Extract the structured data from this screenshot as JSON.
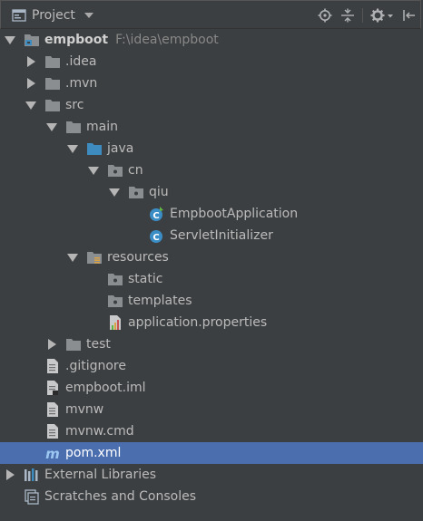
{
  "header": {
    "title": "Project",
    "icons": [
      "project-view-icon",
      "chevron-down-icon",
      "locate-icon",
      "collapse-all-icon",
      "gear-icon",
      "hide-icon"
    ]
  },
  "tree": {
    "items": [
      {
        "label": "empboot",
        "hint": "F:\\idea\\empboot",
        "icon": "module-folder-icon",
        "expanded": true
      },
      {
        "label": ".idea",
        "icon": "folder-icon",
        "expanded": false
      },
      {
        "label": ".mvn",
        "icon": "folder-icon",
        "expanded": false
      },
      {
        "label": "src",
        "icon": "folder-icon",
        "expanded": true
      },
      {
        "label": "main",
        "icon": "folder-icon",
        "expanded": true
      },
      {
        "label": "java",
        "icon": "source-folder-icon",
        "expanded": true
      },
      {
        "label": "cn",
        "icon": "package-icon",
        "expanded": true
      },
      {
        "label": "qiu",
        "icon": "package-icon",
        "expanded": true
      },
      {
        "label": "EmpbootApplication",
        "icon": "spring-boot-class-icon"
      },
      {
        "label": "ServletInitializer",
        "icon": "class-icon"
      },
      {
        "label": "resources",
        "icon": "resources-folder-icon",
        "expanded": true
      },
      {
        "label": "static",
        "icon": "package-icon"
      },
      {
        "label": "templates",
        "icon": "package-icon"
      },
      {
        "label": "application.properties",
        "icon": "properties-file-icon"
      },
      {
        "label": "test",
        "icon": "folder-icon",
        "expanded": false
      },
      {
        "label": ".gitignore",
        "icon": "text-file-icon"
      },
      {
        "label": "empboot.iml",
        "icon": "iml-file-icon"
      },
      {
        "label": "mvnw",
        "icon": "text-file-icon"
      },
      {
        "label": "mvnw.cmd",
        "icon": "text-file-icon"
      },
      {
        "label": "pom.xml",
        "icon": "maven-icon",
        "selected": true
      },
      {
        "label": "External Libraries",
        "icon": "libraries-icon",
        "expanded": false
      },
      {
        "label": "Scratches and Consoles",
        "icon": "scratches-icon"
      }
    ]
  },
  "colors": {
    "background": "#3c3f41",
    "selection": "#4b6eaf",
    "text": "#bbbbbb",
    "hint": "#888888",
    "folder": "#8a8e91",
    "source_folder": "#3d8bbf",
    "class_badge": "#3b8dc6",
    "spring_green": "#62b543",
    "maven_blue": "#3f9bdb"
  }
}
